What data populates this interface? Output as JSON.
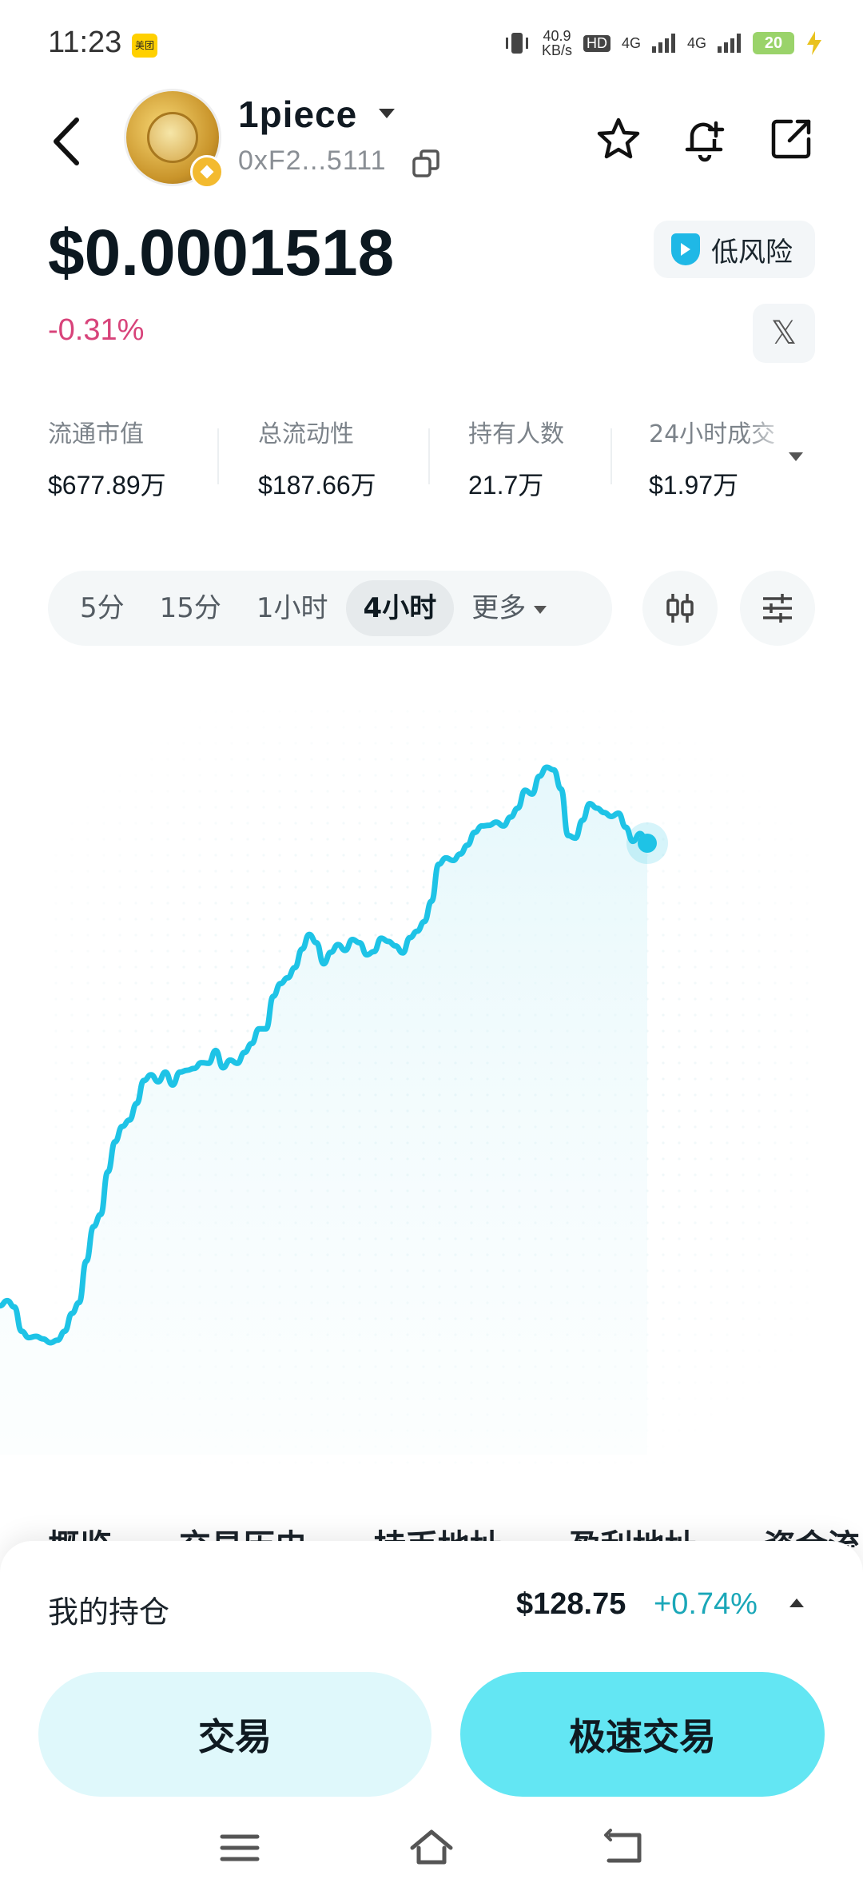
{
  "status_bar": {
    "time": "11:23",
    "meituan_badge": "美团",
    "net_speed_value": "40.9",
    "net_speed_unit": "KB/s",
    "hd_label": "HD",
    "signal_1": "4G",
    "signal_2": "4G",
    "battery": "20"
  },
  "token": {
    "name": "1piece",
    "address": "0xF2...5111",
    "price": "$0.0001518",
    "change": "-0.31%",
    "risk_label": "低风险",
    "x_label": "𝕏"
  },
  "stats": [
    {
      "label": "流通市值",
      "value": "$677.89万"
    },
    {
      "label": "总流动性",
      "value": "$187.66万"
    },
    {
      "label": "持有人数",
      "value": "21.7万"
    },
    {
      "label": "24小时成交",
      "value": "$1.97万"
    }
  ],
  "timeframes": [
    {
      "label": "5分",
      "active": false
    },
    {
      "label": "15分",
      "active": false
    },
    {
      "label": "1小时",
      "active": false
    },
    {
      "label": "4小时",
      "active": true
    },
    {
      "label": "更多",
      "active": false
    }
  ],
  "chart_data": {
    "type": "line",
    "title": "",
    "xlabel": "",
    "ylabel": "",
    "grid": true,
    "legend": "none",
    "color": "#1ec3e6",
    "fill": "#e9f9fc",
    "values": [
      1120,
      1128,
      1118,
      1080,
      1070,
      1072,
      1068,
      1062,
      1066,
      1080,
      1108,
      1125,
      1190,
      1244,
      1263,
      1330,
      1377,
      1401,
      1411,
      1437,
      1473,
      1482,
      1471,
      1486,
      1466,
      1486,
      1489,
      1492,
      1501,
      1500,
      1520,
      1493,
      1505,
      1500,
      1517,
      1531,
      1554,
      1554,
      1605,
      1625,
      1634,
      1650,
      1679,
      1702,
      1689,
      1656,
      1674,
      1686,
      1677,
      1694,
      1689,
      1670,
      1675,
      1696,
      1691,
      1684,
      1673,
      1697,
      1707,
      1722,
      1754,
      1812,
      1822,
      1818,
      1828,
      1842,
      1862,
      1872,
      1873,
      1878,
      1872,
      1886,
      1900,
      1928,
      1922,
      1950,
      1964,
      1960,
      1930,
      1857,
      1853,
      1881,
      1907,
      1900,
      1893,
      1887,
      1892,
      1870,
      1848,
      1860,
      1845
    ]
  },
  "tabs_peek": [
    "概览",
    "交易历史",
    "持币地址",
    "盈利地址",
    "资金流"
  ],
  "holding": {
    "label": "我的持仓",
    "value": "$128.75",
    "change": "+0.74%"
  },
  "buttons": {
    "trade": "交易",
    "fast_trade": "极速交易"
  }
}
